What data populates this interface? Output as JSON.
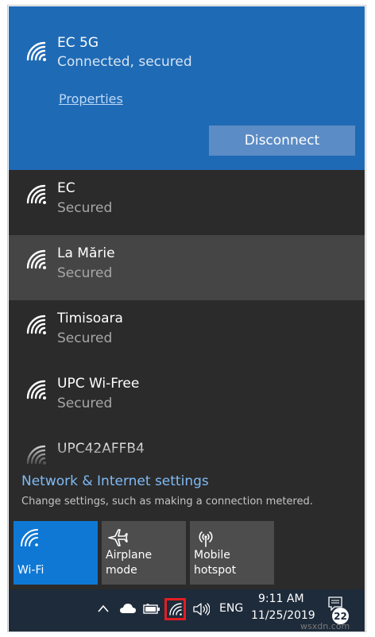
{
  "connected": {
    "name": "EC 5G",
    "status": "Connected, secured",
    "properties_label": "Properties",
    "disconnect_label": "Disconnect"
  },
  "networks": [
    {
      "name": "EC",
      "status": "Secured"
    },
    {
      "name": "La Mărie",
      "status": "Secured"
    },
    {
      "name": "Timisoara",
      "status": "Secured"
    },
    {
      "name": "UPC Wi-Free",
      "status": "Secured"
    },
    {
      "name": "UPC42AFFB4",
      "status": ""
    }
  ],
  "settings": {
    "link": "Network & Internet settings",
    "description": "Change settings, such as making a connection metered."
  },
  "tiles": [
    {
      "label": "Wi-Fi",
      "icon": "wifi-icon",
      "active": true
    },
    {
      "label": "Airplane mode",
      "icon": "airplane-icon",
      "active": false
    },
    {
      "label": "Mobile\nhotspot",
      "icon": "hotspot-icon",
      "active": false
    }
  ],
  "taskbar": {
    "language": "ENG",
    "time": "9:11 AM",
    "date": "11/25/2019",
    "notification_count": "22",
    "icons": [
      "chevron-up-icon",
      "cloud-icon",
      "battery-icon",
      "wifi-icon",
      "volume-icon",
      "notification-icon"
    ]
  },
  "watermark": "wsxdn.com",
  "colors": {
    "accent": "#1f6ab5",
    "tile_active": "#0f78d4",
    "flyout_bg": "#2b2b2b",
    "taskbar_bg": "#1e2b3a",
    "highlight": "#e11e24"
  }
}
